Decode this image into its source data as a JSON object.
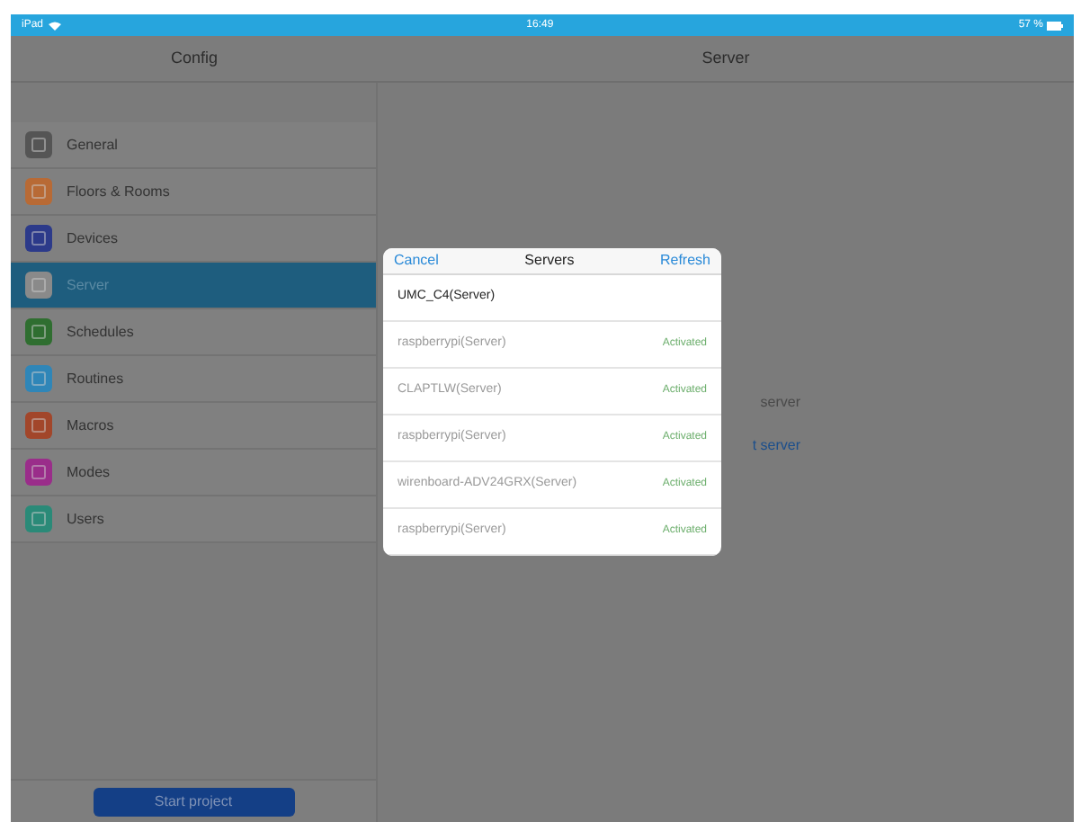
{
  "status_bar": {
    "device": "iPad",
    "time": "16:49",
    "battery": "57 %"
  },
  "nav": {
    "left_title": "Config",
    "right_title": "Server"
  },
  "sidebar": {
    "items": [
      {
        "label": "General",
        "color": "#555555",
        "selected": false
      },
      {
        "label": "Floors & Rooms",
        "color": "#b86a35",
        "selected": false
      },
      {
        "label": "Devices",
        "color": "#2c3a8a",
        "selected": false
      },
      {
        "label": "Server",
        "color": "#8a8a8a",
        "selected": true
      },
      {
        "label": "Schedules",
        "color": "#2f6e30",
        "selected": false
      },
      {
        "label": "Routines",
        "color": "#2f86b8",
        "selected": false
      },
      {
        "label": "Macros",
        "color": "#a2462a",
        "selected": false
      },
      {
        "label": "Modes",
        "color": "#9a2d8a",
        "selected": false
      },
      {
        "label": "Users",
        "color": "#2a8a78",
        "selected": false
      }
    ],
    "button": "Start project"
  },
  "background_texts": [
    {
      "text": "server",
      "kind": "plain"
    },
    {
      "text": "t server",
      "kind": "link"
    }
  ],
  "dialog": {
    "cancel": "Cancel",
    "title": "Servers",
    "refresh": "Refresh",
    "rows": [
      {
        "name": "UMC_C4(Server)",
        "status": "",
        "disabled": false
      },
      {
        "name": "raspberrypi(Server)",
        "status": "Activated",
        "disabled": true
      },
      {
        "name": "CLAPTLW(Server)",
        "status": "Activated",
        "disabled": true
      },
      {
        "name": "raspberrypi(Server)",
        "status": "Activated",
        "disabled": true
      },
      {
        "name": "wirenboard-ADV24GRX(Server)",
        "status": "Activated",
        "disabled": true
      },
      {
        "name": "raspberrypi(Server)",
        "status": "Activated",
        "disabled": true
      }
    ]
  }
}
